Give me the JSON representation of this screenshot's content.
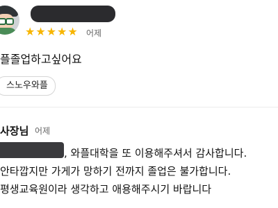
{
  "review": {
    "rating": 5,
    "stars": [
      "★",
      "★",
      "★",
      "★",
      "★"
    ],
    "date": "어제",
    "text": "플졸업하고싶어요",
    "menu_tag": "스노우와플"
  },
  "owner_reply": {
    "label": "사장님",
    "date": "어제",
    "lines": [
      ", 와플대학을 또 이용해주셔서 감사합니다.",
      "안타깝지만 가게가 망하기 전까지 졸업은 불가합니다.",
      "평생교육원이라 생각하고 애용해주시기 바랍니다"
    ]
  },
  "colors": {
    "star": "#f7b500",
    "redaction": "#2b2b2e",
    "text": "#111111",
    "muted": "#666666"
  },
  "icons": {
    "avatar": "user-avatar-icon",
    "star": "star-icon"
  }
}
